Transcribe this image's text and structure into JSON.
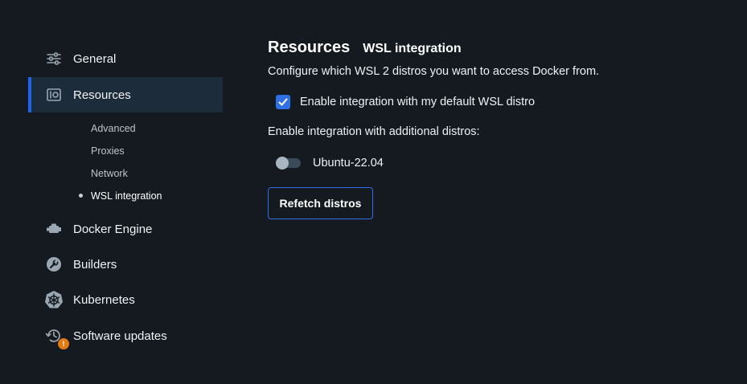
{
  "sidebar": {
    "items": [
      {
        "label": "General",
        "icon": "sliders-icon"
      },
      {
        "label": "Resources",
        "icon": "resources-icon"
      },
      {
        "label": "Docker Engine",
        "icon": "engine-icon"
      },
      {
        "label": "Builders",
        "icon": "wrench-icon"
      },
      {
        "label": "Kubernetes",
        "icon": "kubernetes-icon"
      },
      {
        "label": "Software updates",
        "icon": "update-icon",
        "badge": "!"
      }
    ],
    "sub_items": [
      "Advanced",
      "Proxies",
      "Network",
      "WSL integration"
    ],
    "active_item": "Resources",
    "current_sub_item": "WSL integration"
  },
  "main": {
    "title": "Resources",
    "subtitle": "WSL integration",
    "description": "Configure which WSL 2 distros you want to access Docker from.",
    "default_integration": {
      "label": "Enable integration with my default WSL distro",
      "checked": true
    },
    "additional_label": "Enable integration with additional distros:",
    "distros": [
      {
        "name": "Ubuntu-22.04",
        "enabled": false
      }
    ],
    "refetch_button": "Refetch distros"
  },
  "colors": {
    "background": "#141a1f",
    "accent": "#1d63ed",
    "active_bg": "#1d2c3b",
    "badge": "#e27a13"
  }
}
